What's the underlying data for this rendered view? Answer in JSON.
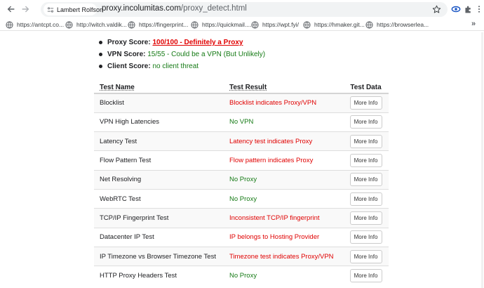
{
  "browser": {
    "profile_name": "Lambert Rolfson",
    "url_host": "proxy.incolumitas.com",
    "url_path": "/proxy_detect.html"
  },
  "bookmarks": [
    {
      "label": "https://antcpt.co...",
      "icon": "globe-icon"
    },
    {
      "label": "http://witch.valdik...",
      "icon": "globe-icon"
    },
    {
      "label": "https://fingerprint...",
      "icon": "globe-icon"
    },
    {
      "label": "https://quickmail....",
      "icon": "globe-icon"
    },
    {
      "label": "https://wpt.fyi/",
      "icon": "globe-icon"
    },
    {
      "label": "https://hmaker.git...",
      "icon": "globe-icon"
    },
    {
      "label": "https://browserlea...",
      "icon": "globe-icon"
    }
  ],
  "scores": {
    "proxy_label": "Proxy Score:",
    "proxy_value": "100/100 - Definitely a Proxy",
    "vpn_label": "VPN Score:",
    "vpn_value": "15/55 - Could be a VPN (But Unlikely)",
    "client_label": "Client Score:",
    "client_value": "no client threat"
  },
  "table": {
    "headers": [
      "Test Name",
      "Test Result",
      "Test Data"
    ],
    "button_label": "More Info",
    "rows": [
      {
        "name": "Blocklist",
        "result": "Blocklist indicates Proxy/VPN",
        "status": "red"
      },
      {
        "name": "VPN High Latencies",
        "result": "No VPN",
        "status": "green"
      },
      {
        "name": "Latency Test",
        "result": "Latency test indicates Proxy",
        "status": "red"
      },
      {
        "name": "Flow Pattern Test",
        "result": "Flow pattern indicates Proxy",
        "status": "red"
      },
      {
        "name": "Net Resolving",
        "result": "No Proxy",
        "status": "green"
      },
      {
        "name": "WebRTC Test",
        "result": "No Proxy",
        "status": "green"
      },
      {
        "name": "TCP/IP Fingerprint Test",
        "result": "Inconsistent TCP/IP fingerprint",
        "status": "red"
      },
      {
        "name": "Datacenter IP Test",
        "result": "IP belongs to Hosting Provider",
        "status": "red"
      },
      {
        "name": "IP Timezone vs Browser Timezone Test",
        "result": "Timezone test indicates Proxy/VPN",
        "status": "red"
      },
      {
        "name": "HTTP Proxy Headers Test",
        "result": "No Proxy",
        "status": "green"
      }
    ]
  },
  "colors": {
    "danger": "#e00000",
    "ok": "#157a15"
  }
}
